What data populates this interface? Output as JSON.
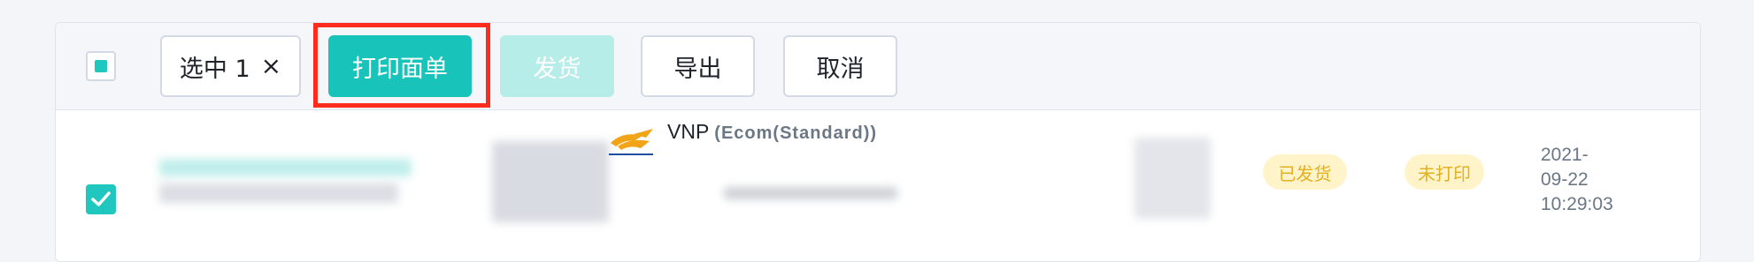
{
  "toolbar": {
    "selected_label": "选中 1",
    "clear_symbol": "×",
    "print_label": "打印面单",
    "ship_label": "发货",
    "export_label": "导出",
    "cancel_label": "取消"
  },
  "row": {
    "carrier": {
      "name": "VNP",
      "service": "(Ecom(Standard))",
      "logo_icon": "vnpost-logo"
    },
    "ship_status": "已发货",
    "print_status": "未打印",
    "datetime_lines": [
      "2021-",
      "09-22",
      "10:29:03"
    ]
  },
  "colors": {
    "accent": "#18c3b9",
    "accent_disabled": "#b6ede9",
    "highlight": "#ff2b1c",
    "tag_bg": "#fff4c9",
    "tag_text": "#e3b024"
  }
}
